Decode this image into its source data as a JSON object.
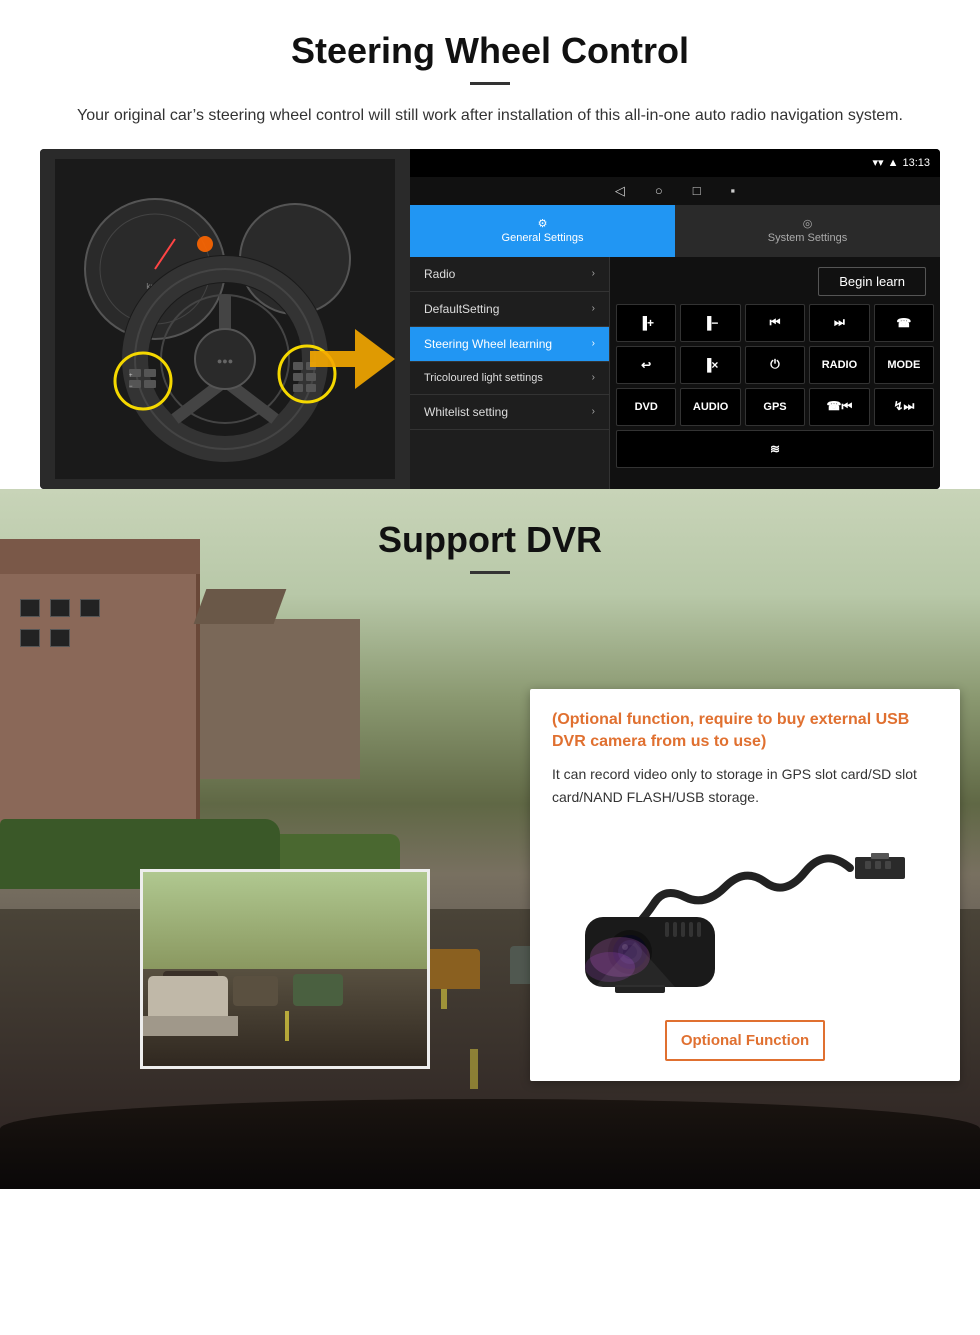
{
  "section1": {
    "title": "Steering Wheel Control",
    "subtitle": "Your original car’s steering wheel control will still work after installation of this all-in-one auto radio navigation system.",
    "android_ui": {
      "statusbar": {
        "time": "13:13",
        "wifi_icon": "▾",
        "signal_icon": "▾"
      },
      "navbar": {
        "back": "◁",
        "home": "○",
        "recents": "□",
        "dvr": "■"
      },
      "tabs": {
        "general": "General Settings",
        "system": "System Settings"
      },
      "menu_items": [
        {
          "label": "Radio",
          "active": false
        },
        {
          "label": "DefaultSetting",
          "active": false
        },
        {
          "label": "Steering Wheel learning",
          "active": true
        },
        {
          "label": "Tricoloured light settings",
          "active": false
        },
        {
          "label": "Whitelist setting",
          "active": false
        }
      ],
      "begin_learn": "Begin learn",
      "control_buttons": [
        [
          "❙+",
          "❙−",
          "⏮",
          "⏭",
          "☎"
        ],
        [
          "↩",
          "❙×",
          "⏻",
          "RADIO",
          "MODE"
        ],
        [
          "DVD",
          "AUDIO",
          "GPS",
          "☎⏮",
          "℧⏭"
        ],
        [
          "‹□"
        ]
      ]
    }
  },
  "section2": {
    "title": "Support DVR",
    "info_card": {
      "optional_text": "(Optional function, require to buy external USB DVR camera from us to use)",
      "description": "It can record video only to storage in GPS slot card/SD slot card/NAND FLASH/USB storage.",
      "optional_button": "Optional Function"
    }
  }
}
